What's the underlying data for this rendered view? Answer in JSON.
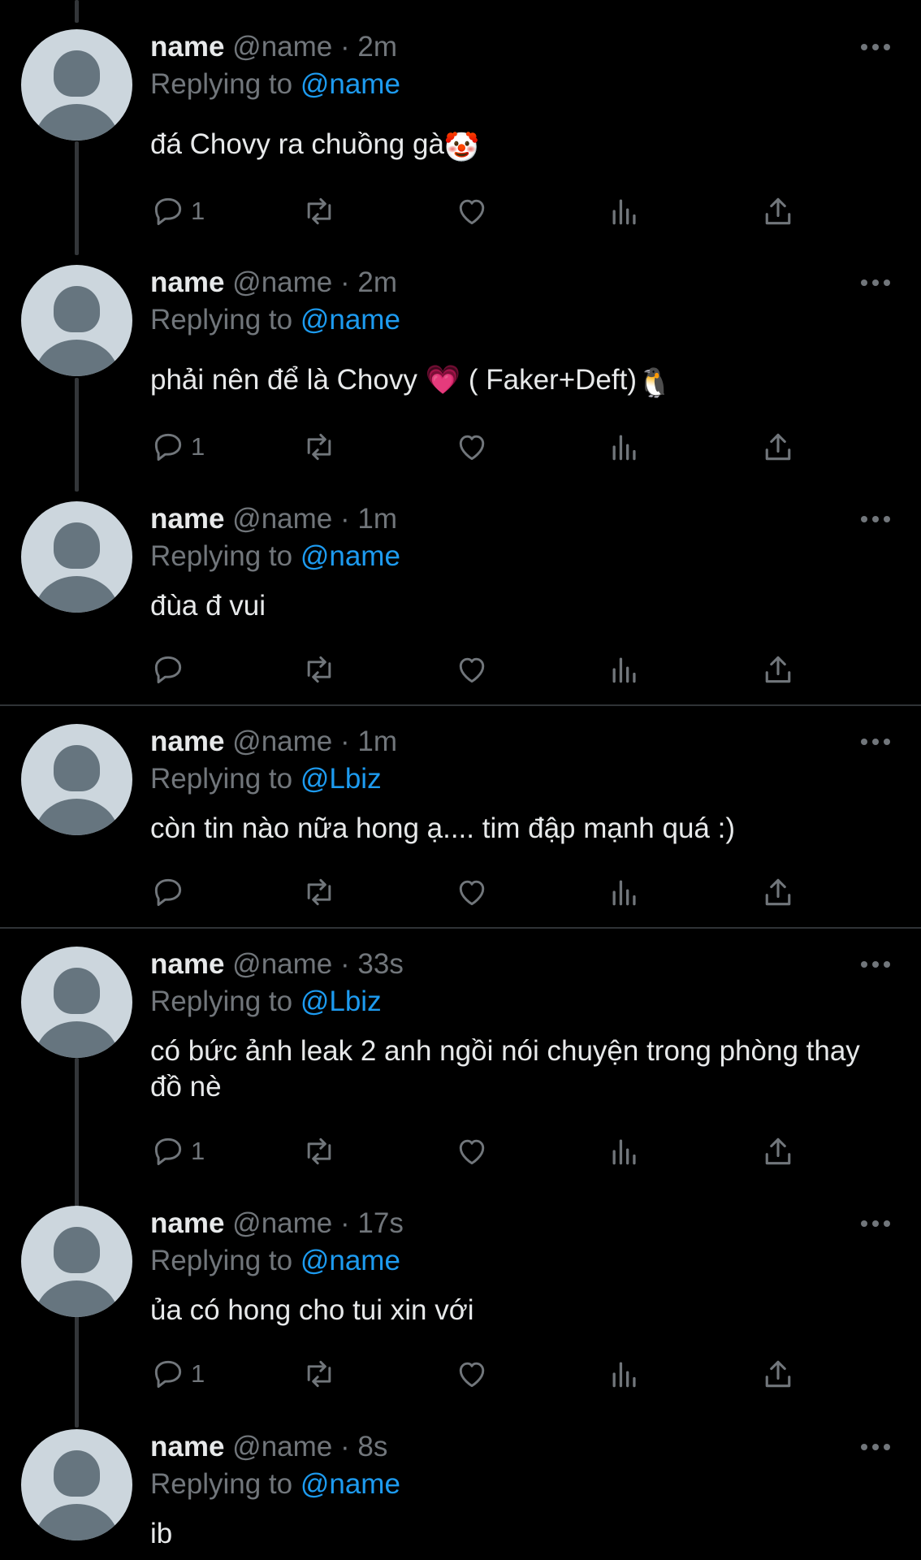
{
  "colors": {
    "background": "#000000",
    "text": "#e7e9ea",
    "muted": "#71767b",
    "mention": "#1d9bf0",
    "avatar_bg": "#ccd6dd",
    "avatar_fg": "#66757f",
    "divider": "#2f3336"
  },
  "icons": {
    "reply": "speech-bubble-icon",
    "retweet": "retweet-arrows-icon",
    "like": "heart-icon",
    "views": "bar-chart-icon",
    "share": "share-upload-icon",
    "more": "more-dots-icon"
  },
  "tweets": [
    {
      "name": "name",
      "handle": "@name",
      "separator": "·",
      "time": "2m",
      "replying_label": "Replying to",
      "replying_to": "@name",
      "text": "đá Chovy ra chuồng gà",
      "emoji": "🤡",
      "reply_count": "1"
    },
    {
      "name": "name",
      "handle": "@name",
      "separator": "·",
      "time": "2m",
      "replying_label": "Replying to",
      "replying_to": "@name",
      "text": "phải nên để là Chovy 💗  ( Faker+Deft)",
      "emoji": "🐧",
      "reply_count": "1"
    },
    {
      "name": "name",
      "handle": "@name",
      "separator": "·",
      "time": "1m",
      "replying_label": "Replying to",
      "replying_to": "@name",
      "text": "đùa đ vui",
      "reply_count": ""
    },
    {
      "name": "name",
      "handle": "@name",
      "separator": "·",
      "time": "1m",
      "replying_label": "Replying to",
      "replying_to": "@Lbiz",
      "text": "còn tin nào nữa hong ạ.... tim đập mạnh quá :)",
      "reply_count": ""
    },
    {
      "name": "name",
      "handle": "@name",
      "separator": "·",
      "time": "33s",
      "replying_label": "Replying to",
      "replying_to": "@Lbiz",
      "text": "có bức ảnh leak 2 anh ngồi nói chuyện trong phòng thay đồ nè",
      "reply_count": "1"
    },
    {
      "name": "name",
      "handle": "@name",
      "separator": "·",
      "time": "17s",
      "replying_label": "Replying to",
      "replying_to": "@name",
      "text": "ủa có hong cho tui xin với",
      "reply_count": "1"
    },
    {
      "name": "name",
      "handle": "@name",
      "separator": "·",
      "time": "8s",
      "replying_label": "Replying to",
      "replying_to": "@name",
      "text": "ib"
    }
  ]
}
